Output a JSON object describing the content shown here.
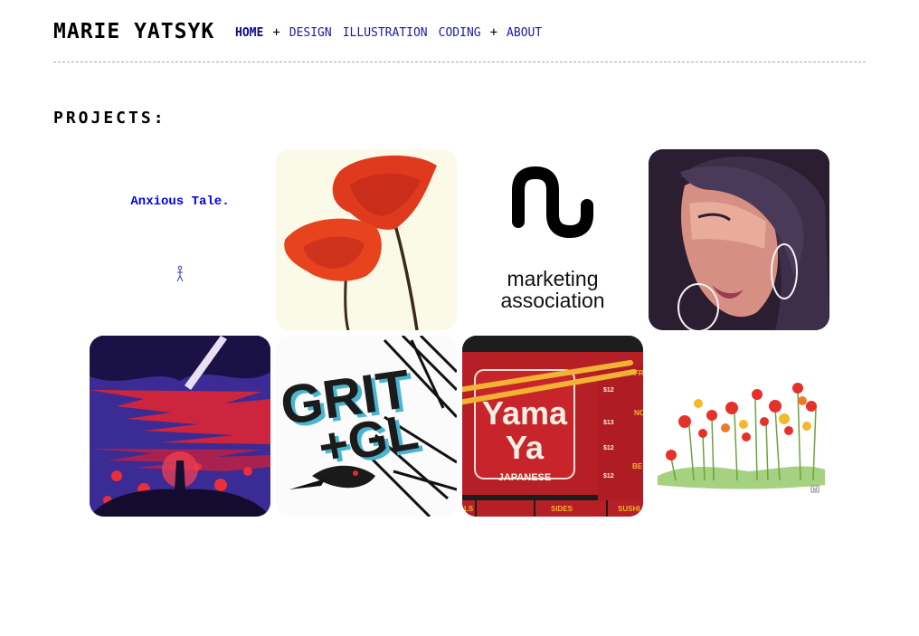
{
  "header": {
    "site_title": "MARIE YATSYK",
    "nav": {
      "home": "HOME",
      "sep1": "+",
      "design": "DESIGN",
      "illustration": "ILLUSTRATION",
      "coding": "CODING",
      "sep2": "+",
      "about": "ABOUT"
    }
  },
  "projects": {
    "heading": "PROJECTS:",
    "anxious_tale": {
      "title": "Anxious Tale."
    },
    "marketing": {
      "line1": "marketing",
      "line2": "association"
    },
    "grit": {
      "word1": "GRIT",
      "word2": "+GL"
    },
    "yamaya": {
      "logo_line1": "Yama",
      "logo_line2": "Ya",
      "logo_sub": "JAPANESE",
      "menu_prices": [
        "$12",
        "$13",
        "$12",
        "$12"
      ],
      "menu_headers": [
        "FR",
        "NO",
        "BE"
      ],
      "tabs": [
        "LS",
        "SIDES",
        "SUSHI"
      ]
    },
    "flowers": {
      "signature": "M"
    }
  },
  "colors": {
    "nav_link": "#1a1aa6",
    "poppy_red": "#e03a1e",
    "yamaya_red": "#c8242b",
    "chopstick": "#f3b233"
  }
}
